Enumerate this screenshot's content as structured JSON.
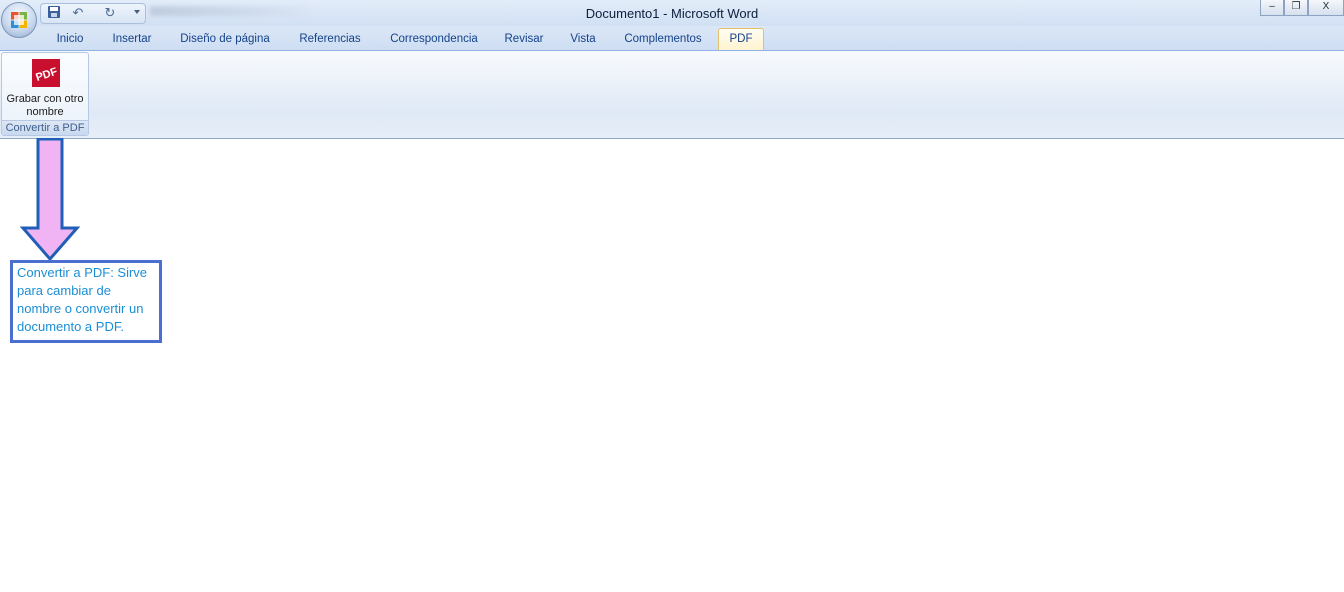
{
  "window": {
    "title": "Documento1 - Microsoft Word",
    "controls": {
      "minimize": "–",
      "maximize": "❐",
      "close": "X"
    }
  },
  "qat": {
    "save_icon": "save-icon",
    "undo_icon": "undo-icon",
    "redo_icon": "redo-icon"
  },
  "tabs": [
    {
      "label": "Inicio"
    },
    {
      "label": "Insertar"
    },
    {
      "label": "Diseño de página"
    },
    {
      "label": "Referencias"
    },
    {
      "label": "Correspondencia"
    },
    {
      "label": "Revisar"
    },
    {
      "label": "Vista"
    },
    {
      "label": "Complementos"
    },
    {
      "label": "PDF",
      "active": true
    }
  ],
  "ribbon": {
    "group_label": "Convertir a PDF",
    "button_label": "Grabar con otro nombre",
    "pdf_icon_text": "PDF"
  },
  "annotation": {
    "text": "Convertir a PDF: Sirve para cambiar de nombre o convertir un documento a PDF."
  },
  "colors": {
    "accent": "#15428b",
    "arrow_fill": "#f0b4f5",
    "arrow_stroke": "#1f5fb8",
    "callout_border": "#4a6fd0",
    "callout_text": "#1a8fd6",
    "pdf_red": "#c8102e"
  }
}
